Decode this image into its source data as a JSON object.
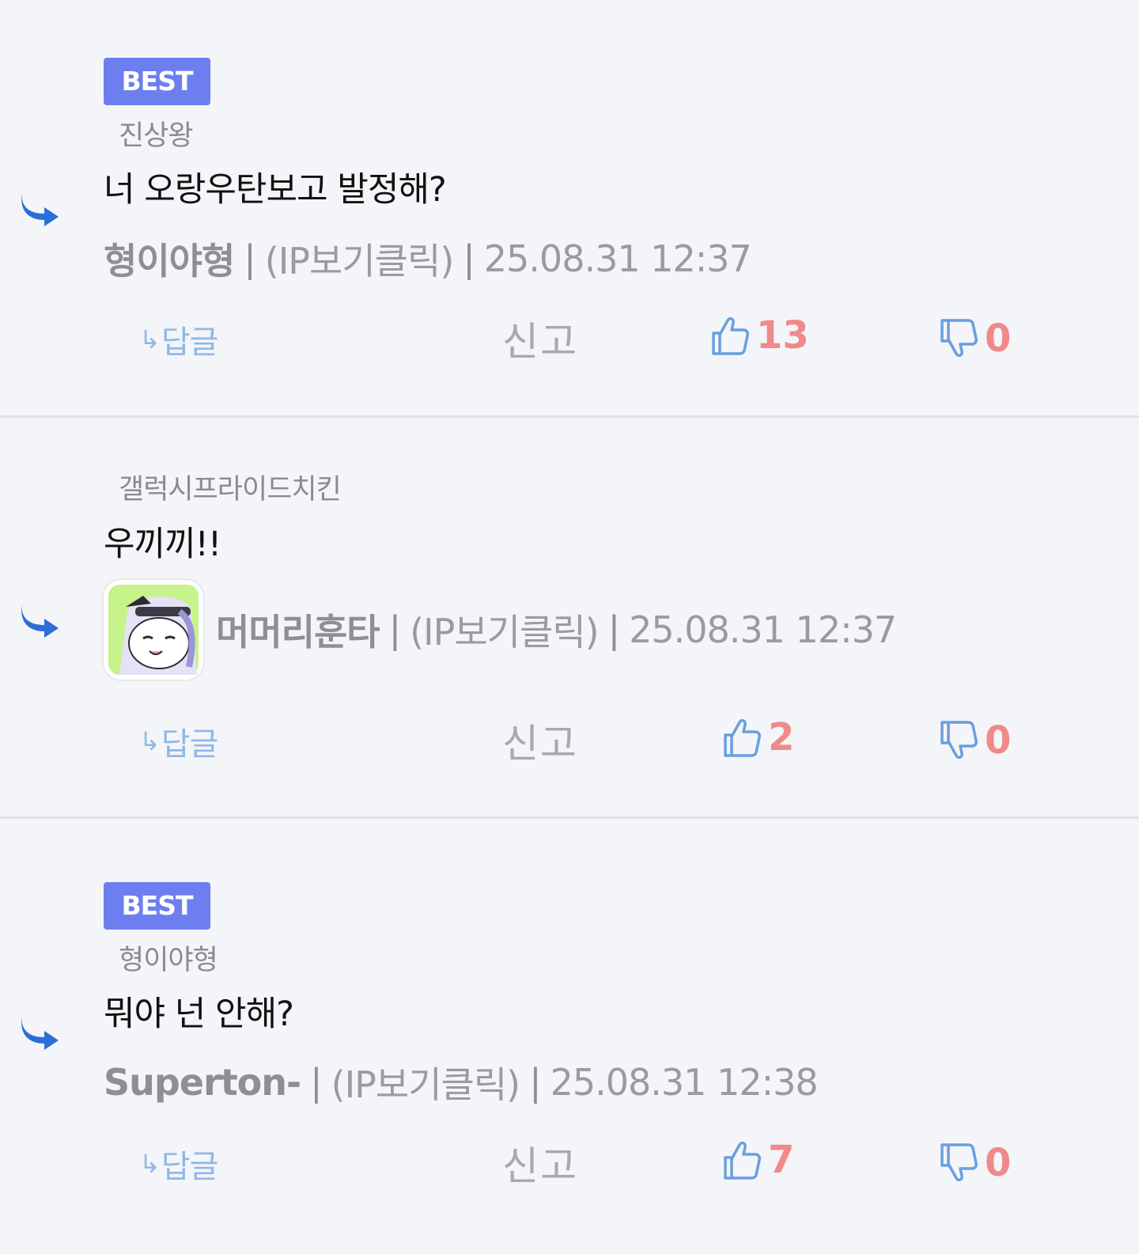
{
  "comments": [
    {
      "badge": "BEST",
      "parent_author": "진상왕",
      "text": "너 오랑우탄보고 발정해?",
      "nickname": "형이야형",
      "ip": "(IP보기클릭)",
      "datetime": "25.08.31 12:37",
      "reply_label": "답글",
      "report_label": "신고",
      "upvotes": "13",
      "downvotes": "0"
    },
    {
      "badge": "",
      "parent_author": "갤럭시프라이드치킨",
      "text": "우끼끼!!",
      "nickname": "머머리훈타",
      "ip": "(IP보기클릭)",
      "datetime": "25.08.31 12:37",
      "reply_label": "답글",
      "report_label": "신고",
      "upvotes": "2",
      "downvotes": "0",
      "avatar": "anime-character-avatar"
    },
    {
      "badge": "BEST",
      "parent_author": "형이야형",
      "text": "뭐야 넌 안해?",
      "nickname": "Superton-",
      "ip": "(IP보기클릭)",
      "datetime": "25.08.31 12:38",
      "reply_label": "답글",
      "report_label": "신고",
      "upvotes": "7",
      "downvotes": "0"
    }
  ],
  "meta_separator": "|",
  "colors": {
    "badge": "#6d7ff0",
    "reply_arrow": "#2a6fd6",
    "upvote_count": "#f08a8a",
    "action_reply": "#8fb8e6"
  }
}
